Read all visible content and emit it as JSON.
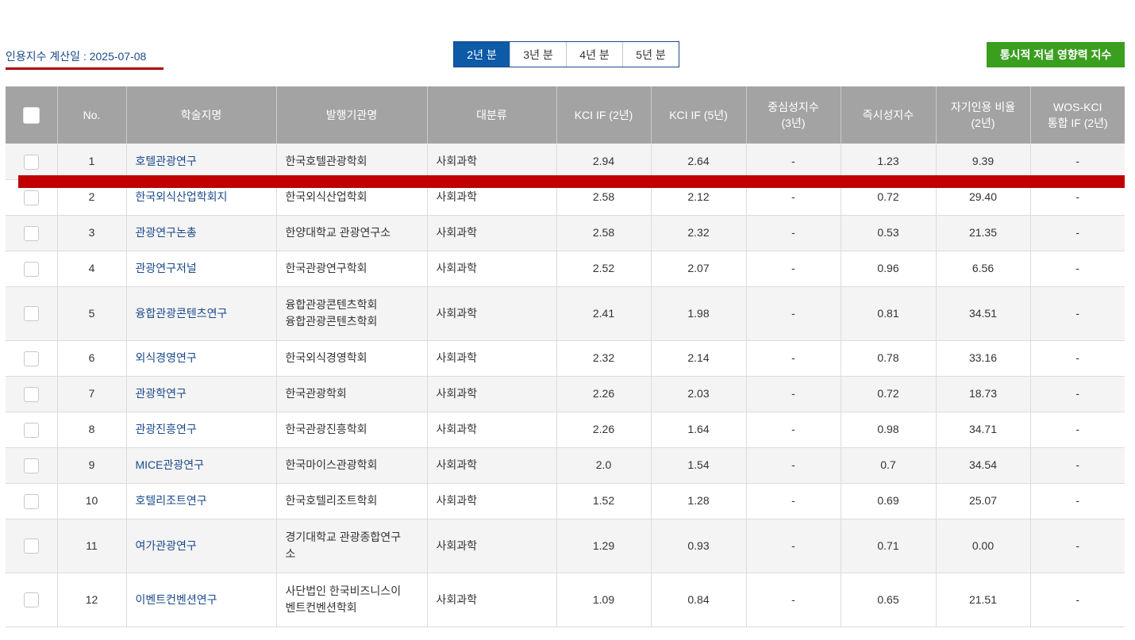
{
  "calc_date_label": "인용지수 계산일 : 2025-07-08",
  "year_tabs": [
    "2년 분",
    "3년 분",
    "4년 분",
    "5년 분"
  ],
  "active_year_tab": "2년 분",
  "diachronic_button": "통시적 저널 영향력 지수",
  "headers": {
    "no": "No.",
    "title": "학술지명",
    "publisher": "발행기관명",
    "category": "대분류",
    "kci2": "KCI IF (2년)",
    "kci5": "KCI IF (5년)",
    "centrality": [
      "중심성지수",
      "(3년)"
    ],
    "immediacy": "즉시성지수",
    "selfcite": [
      "자기인용 비율",
      "(2년)"
    ],
    "wos": [
      "WOS-KCI",
      "통합 IF (2년)"
    ]
  },
  "rows": [
    {
      "no": "1",
      "title": "호텔관광연구",
      "publisher": [
        "한국호텔관광학회"
      ],
      "category": "사회과학",
      "kci2": "2.94",
      "kci5": "2.64",
      "centrality": "-",
      "immediacy": "1.23",
      "selfcite": "9.39",
      "wos": "-"
    },
    {
      "no": "2",
      "title": "한국외식산업학회지",
      "publisher": [
        "한국외식산업학회"
      ],
      "category": "사회과학",
      "kci2": "2.58",
      "kci5": "2.12",
      "centrality": "-",
      "immediacy": "0.72",
      "selfcite": "29.40",
      "wos": "-"
    },
    {
      "no": "3",
      "title": "관광연구논총",
      "publisher": [
        "한양대학교 관광연구소"
      ],
      "category": "사회과학",
      "kci2": "2.58",
      "kci5": "2.32",
      "centrality": "-",
      "immediacy": "0.53",
      "selfcite": "21.35",
      "wos": "-"
    },
    {
      "no": "4",
      "title": "관광연구저널",
      "publisher": [
        "한국관광연구학회"
      ],
      "category": "사회과학",
      "kci2": "2.52",
      "kci5": "2.07",
      "centrality": "-",
      "immediacy": "0.96",
      "selfcite": "6.56",
      "wos": "-"
    },
    {
      "no": "5",
      "title": "융합관광콘텐츠연구",
      "publisher": [
        "융합관광콘텐츠학회",
        "융합관광콘텐츠학회"
      ],
      "category": "사회과학",
      "kci2": "2.41",
      "kci5": "1.98",
      "centrality": "-",
      "immediacy": "0.81",
      "selfcite": "34.51",
      "wos": "-"
    },
    {
      "no": "6",
      "title": "외식경영연구",
      "publisher": [
        "한국외식경영학회"
      ],
      "category": "사회과학",
      "kci2": "2.32",
      "kci5": "2.14",
      "centrality": "-",
      "immediacy": "0.78",
      "selfcite": "33.16",
      "wos": "-"
    },
    {
      "no": "7",
      "title": "관광학연구",
      "publisher": [
        "한국관광학회"
      ],
      "category": "사회과학",
      "kci2": "2.26",
      "kci5": "2.03",
      "centrality": "-",
      "immediacy": "0.72",
      "selfcite": "18.73",
      "wos": "-"
    },
    {
      "no": "8",
      "title": "관광진흥연구",
      "publisher": [
        "한국관광진흥학회"
      ],
      "category": "사회과학",
      "kci2": "2.26",
      "kci5": "1.64",
      "centrality": "-",
      "immediacy": "0.98",
      "selfcite": "34.71",
      "wos": "-"
    },
    {
      "no": "9",
      "title": "MICE관광연구",
      "publisher": [
        "한국마이스관광학회"
      ],
      "category": "사회과학",
      "kci2": "2.0",
      "kci5": "1.54",
      "centrality": "-",
      "immediacy": "0.7",
      "selfcite": "34.54",
      "wos": "-"
    },
    {
      "no": "10",
      "title": "호텔리조트연구",
      "publisher": [
        "한국호텔리조트학회"
      ],
      "category": "사회과학",
      "kci2": "1.52",
      "kci5": "1.28",
      "centrality": "-",
      "immediacy": "0.69",
      "selfcite": "25.07",
      "wos": "-"
    },
    {
      "no": "11",
      "title": "여가관광연구",
      "publisher": [
        "경기대학교 관광종합연구",
        "소"
      ],
      "category": "사회과학",
      "kci2": "1.29",
      "kci5": "0.93",
      "centrality": "-",
      "immediacy": "0.71",
      "selfcite": "0.00",
      "wos": "-"
    },
    {
      "no": "12",
      "title": "이벤트컨벤션연구",
      "publisher": [
        "사단법인 한국비즈니스이",
        "벤트컨벤션학회"
      ],
      "category": "사회과학",
      "kci2": "1.09",
      "kci5": "0.84",
      "centrality": "-",
      "immediacy": "0.65",
      "selfcite": "21.51",
      "wos": "-"
    }
  ],
  "colors": {
    "header_bg": "#a3a3a3",
    "active_tab": "#0d5aa7",
    "green_button": "#3a9e1f",
    "link_text": "#1a4a8a",
    "highlight_bar": "#c00000"
  }
}
